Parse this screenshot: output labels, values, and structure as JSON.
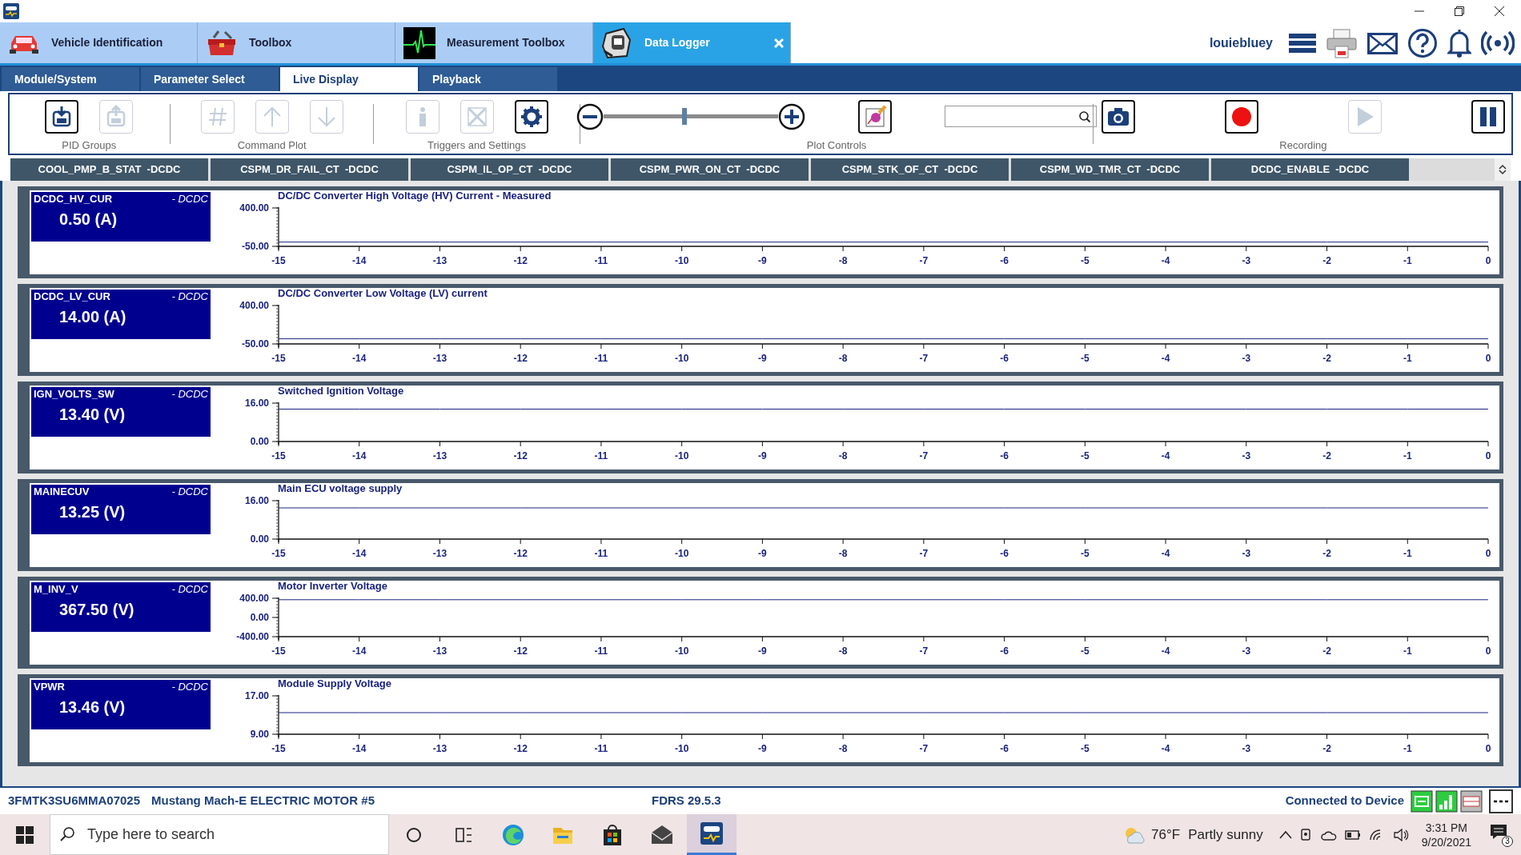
{
  "app_tabs": [
    {
      "label": "Vehicle Identification",
      "kind": "car",
      "selected": false,
      "closable": false
    },
    {
      "label": "Toolbox",
      "kind": "toolbox",
      "selected": false,
      "closable": false
    },
    {
      "label": "Measurement Toolbox",
      "kind": "scope",
      "selected": false,
      "closable": false
    },
    {
      "label": "Data Logger",
      "kind": "logger",
      "selected": true,
      "closable": true
    }
  ],
  "user": {
    "name": "louiebluey"
  },
  "sub_tabs": [
    {
      "label": "Module/System",
      "selected": false
    },
    {
      "label": "Parameter Select",
      "selected": false
    },
    {
      "label": "Live Display",
      "selected": true
    },
    {
      "label": "Playback",
      "selected": false
    }
  ],
  "toolbar": {
    "groups": [
      {
        "label": "PID Groups",
        "buttons": [
          {
            "kind": "load",
            "disabled": false
          },
          {
            "kind": "save",
            "disabled": true
          }
        ]
      },
      {
        "label": "Command Plot",
        "buttons": [
          {
            "kind": "hash",
            "disabled": true
          },
          {
            "kind": "up",
            "disabled": true
          },
          {
            "kind": "down",
            "disabled": true
          }
        ]
      },
      {
        "label": "Triggers and Settings",
        "buttons": [
          {
            "kind": "info",
            "disabled": true
          },
          {
            "kind": "clear",
            "disabled": true
          },
          {
            "kind": "gear",
            "disabled": false
          }
        ]
      },
      {
        "label": "Plot Controls",
        "zoom": {
          "level": 0.45
        },
        "buttons": [
          {
            "kind": "plot",
            "disabled": false
          }
        ]
      },
      {
        "label": "Recording",
        "buttons": [
          {
            "kind": "camera",
            "disabled": false
          },
          {
            "kind": "record",
            "disabled": false
          },
          {
            "kind": "play",
            "disabled": true
          },
          {
            "kind": "pause",
            "disabled": false
          }
        ]
      }
    ]
  },
  "pid_headers": [
    "COOL_PMP_B_STAT  -DCDC",
    "CSPM_DR_FAIL_CT  -DCDC",
    "CSPM_IL_OP_CT  -DCDC",
    "CSPM_PWR_ON_CT  -DCDC",
    "CSPM_STK_OF_CT  -DCDC",
    "CSPM_WD_TMR_CT  -DCDC",
    "DCDC_ENABLE  -DCDC"
  ],
  "panels": [
    {
      "name": "DCDC_HV_CUR",
      "module": "- DCDC",
      "value": "0.50 (A)",
      "chart_data": {
        "type": "line",
        "title": "DC/DC Converter High Voltage (HV) Current - Measured",
        "categories": [
          "-15",
          "-14",
          "-13",
          "-12",
          "-11",
          "-10",
          "-9",
          "-8",
          "-7",
          "-6",
          "-5",
          "-4",
          "-3",
          "-2",
          "-1",
          "0"
        ],
        "series": [
          {
            "color": "#1a237e",
            "values": [
              0,
              0,
              0,
              0,
              0,
              0,
              0,
              0,
              0,
              0,
              0,
              0,
              0,
              0,
              0,
              0
            ]
          }
        ],
        "ylim": [
          -50,
          400
        ],
        "yticks": [
          {
            "value": 400,
            "label": "400.00"
          },
          {
            "value": -50,
            "label": "-50.00"
          }
        ]
      }
    },
    {
      "name": "DCDC_LV_CUR",
      "module": "- DCDC",
      "value": "14.00 (A)",
      "chart_data": {
        "type": "line",
        "title": "DC/DC Converter Low Voltage (LV) current",
        "categories": [
          "-15",
          "-14",
          "-13",
          "-12",
          "-11",
          "-10",
          "-9",
          "-8",
          "-7",
          "-6",
          "-5",
          "-4",
          "-3",
          "-2",
          "-1",
          "0"
        ],
        "series": [
          {
            "color": "#1a237e",
            "values": [
              10,
              10,
              10,
              10,
              10,
              10,
              10,
              10,
              10,
              10,
              10,
              10,
              10,
              10,
              10,
              10
            ]
          }
        ],
        "ylim": [
          -50,
          400
        ],
        "yticks": [
          {
            "value": 400,
            "label": "400.00"
          },
          {
            "value": -50,
            "label": "-50.00"
          }
        ]
      }
    },
    {
      "name": "IGN_VOLTS_SW",
      "module": "- DCDC",
      "value": "13.40 (V)",
      "chart_data": {
        "type": "line",
        "title": "Switched Ignition Voltage",
        "categories": [
          "-15",
          "-14",
          "-13",
          "-12",
          "-11",
          "-10",
          "-9",
          "-8",
          "-7",
          "-6",
          "-5",
          "-4",
          "-3",
          "-2",
          "-1",
          "0"
        ],
        "series": [
          {
            "color": "#1a237e",
            "values": [
              13.5,
              13.5,
              13.5,
              13.5,
              13.5,
              13.5,
              13.5,
              13.5,
              13.5,
              13.5,
              13.5,
              13.5,
              13.5,
              13.5,
              13.5,
              13.5
            ]
          }
        ],
        "ylim": [
          0,
          16
        ],
        "yticks": [
          {
            "value": 16,
            "label": "16.00"
          },
          {
            "value": 0,
            "label": "0.00"
          }
        ]
      }
    },
    {
      "name": "MAINECUV",
      "module": "- DCDC",
      "value": "13.25 (V)",
      "chart_data": {
        "type": "line",
        "title": "Main ECU voltage supply",
        "categories": [
          "-15",
          "-14",
          "-13",
          "-12",
          "-11",
          "-10",
          "-9",
          "-8",
          "-7",
          "-6",
          "-5",
          "-4",
          "-3",
          "-2",
          "-1",
          "0"
        ],
        "series": [
          {
            "color": "#1a237e",
            "values": [
              13,
              13,
              13,
              13,
              13,
              13,
              13,
              13,
              13,
              13,
              13,
              13,
              13,
              13,
              13,
              13
            ]
          }
        ],
        "ylim": [
          0,
          16
        ],
        "yticks": [
          {
            "value": 16,
            "label": "16.00"
          },
          {
            "value": 0,
            "label": "0.00"
          }
        ]
      }
    },
    {
      "name": "M_INV_V",
      "module": "- DCDC",
      "value": "367.50 (V)",
      "chart_data": {
        "type": "line",
        "title": "Motor Inverter Voltage",
        "categories": [
          "-15",
          "-14",
          "-13",
          "-12",
          "-11",
          "-10",
          "-9",
          "-8",
          "-7",
          "-6",
          "-5",
          "-4",
          "-3",
          "-2",
          "-1",
          "0"
        ],
        "series": [
          {
            "color": "#1a237e",
            "values": [
              370,
              370,
              370,
              370,
              370,
              370,
              370,
              370,
              370,
              370,
              370,
              370,
              370,
              370,
              370,
              370
            ]
          }
        ],
        "ylim": [
          -400,
          400
        ],
        "yticks": [
          {
            "value": 400,
            "label": "400.00"
          },
          {
            "value": 0,
            "label": "0.00"
          },
          {
            "value": -400,
            "label": "-400.00"
          }
        ]
      }
    },
    {
      "name": "VPWR",
      "module": "- DCDC",
      "value": "13.46 (V)",
      "chart_data": {
        "type": "line",
        "title": "Module Supply Voltage",
        "categories": [
          "-15",
          "-14",
          "-13",
          "-12",
          "-11",
          "-10",
          "-9",
          "-8",
          "-7",
          "-6",
          "-5",
          "-4",
          "-3",
          "-2",
          "-1",
          "0"
        ],
        "series": [
          {
            "color": "#1a237e",
            "values": [
              13.5,
              13.5,
              13.5,
              13.5,
              13.5,
              13.5,
              13.5,
              13.5,
              13.5,
              13.5,
              13.5,
              13.5,
              13.5,
              13.5,
              13.5,
              13.5
            ]
          }
        ],
        "ylim": [
          9,
          17
        ],
        "yticks": [
          {
            "value": 17,
            "label": "17.00"
          },
          {
            "value": 9,
            "label": "9.00"
          }
        ]
      }
    }
  ],
  "status_bar": {
    "vin": "3FMTK3SU6MMA07025",
    "vehicle": "Mustang Mach-E ELECTRIC MOTOR #5",
    "version": "FDRS 29.5.3",
    "connection": "Connected to Device"
  },
  "taskbar": {
    "search_placeholder": "Type here to search",
    "temperature": "76°F",
    "weather": "Partly sunny",
    "time": "3:31 PM",
    "date": "9/20/2021",
    "notifications": "3"
  }
}
